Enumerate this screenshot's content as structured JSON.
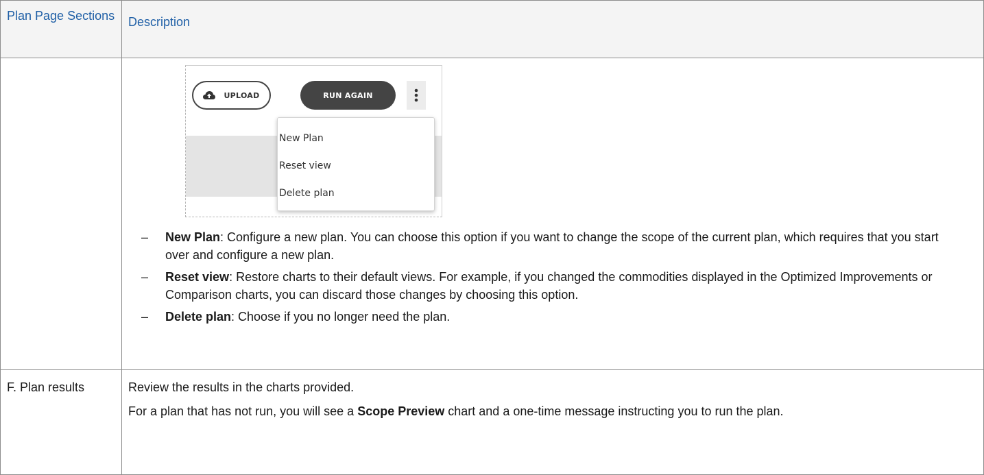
{
  "header": {
    "col1": "Plan Page Sections",
    "col2": "Description"
  },
  "screenshot": {
    "upload_label": "UPLOAD",
    "run_again_label": "RUN AGAIN",
    "upload_icon": "cloud-upload-icon",
    "more_icon": "more-vertical-icon",
    "menu": {
      "items": [
        "New Plan",
        "Reset view",
        "Delete plan"
      ]
    },
    "colors": {
      "dark_button": "#444444",
      "gray_area": "#e4e4e4"
    }
  },
  "row1": {
    "bullets": [
      {
        "dash": "–",
        "term": "New Plan",
        "text": ": Configure a new plan. You can choose this option if you want to change the scope of the current plan, which requires that you start over and configure a new plan."
      },
      {
        "dash": "–",
        "term": "Reset view",
        "text": ": Restore charts to their default views. For example, if you changed the commodities displayed in the Optimized Improvements or Comparison charts, you can discard those changes by choosing this option."
      },
      {
        "dash": "–",
        "term": "Delete plan",
        "text": ": Choose if you no longer need the plan."
      }
    ]
  },
  "row2": {
    "section": "F. Plan results",
    "p1": "Review the results in the charts provided.",
    "p2_before": "For a plan that has not run, you will see a ",
    "p2_term": "Scope Preview",
    "p2_after": " chart and a one-time message instructing you to run the plan."
  },
  "colors": {
    "header_text": "#1f5fa6",
    "header_bg": "#f4f4f4",
    "border": "#8c8c8c"
  }
}
